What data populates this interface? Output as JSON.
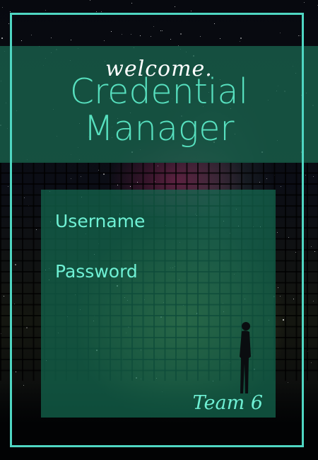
{
  "header": {
    "welcome": "welcome.",
    "title_line1": "Credential",
    "title_line2": "Manager"
  },
  "form": {
    "username_label": "Username",
    "username_value": "",
    "password_label": "Password",
    "password_value": ""
  },
  "footer": {
    "team_label": "Team 6"
  },
  "colors": {
    "accent": "#57e0bf",
    "frame": "#4fd6c2",
    "panel": "#146950",
    "header_band": "#185f4b"
  },
  "icons": {
    "figure": "person-silhouette-icon"
  }
}
